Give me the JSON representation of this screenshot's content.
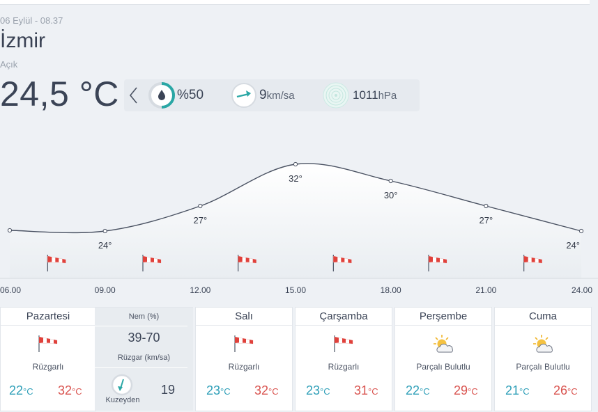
{
  "current": {
    "datetime": "06 Eylül - 08.37",
    "city": "İzmir",
    "condition": "Açık",
    "temperature": "24,5 °C"
  },
  "metrics": {
    "humidity": {
      "prefix": "%",
      "value": "50",
      "fill": 0.5
    },
    "wind": {
      "value": "9",
      "unit": "km/sa"
    },
    "pressure": {
      "value": "1011",
      "unit": "hPa"
    }
  },
  "colors": {
    "teal": "#2aa7a5",
    "hi": "#d9534f",
    "lo": "#2e9fb8",
    "flag_red": "#e0413b"
  },
  "chart_data": {
    "type": "line",
    "x": [
      "06.00",
      "09.00",
      "12.00",
      "15.00",
      "18.00",
      "21.00",
      "24.00"
    ],
    "points": [
      {
        "hour": 6,
        "temp": 24,
        "label": ""
      },
      {
        "hour": 9,
        "temp": 24,
        "label": "24°"
      },
      {
        "hour": 12,
        "temp": 27,
        "label": "27°"
      },
      {
        "hour": 15,
        "temp": 32,
        "label": "32°"
      },
      {
        "hour": 18,
        "temp": 30,
        "label": "30°"
      },
      {
        "hour": 21,
        "temp": 27,
        "label": "27°"
      },
      {
        "hour": 24,
        "temp": 24,
        "label": "24°"
      }
    ],
    "ylim": [
      22,
      33
    ],
    "wind_flags_count": 6
  },
  "today": {
    "day": "Pazartesi",
    "desc": "Rüzgarlı",
    "lo": "22",
    "hi": "32",
    "unit": "°C",
    "humidity_label": "Nem (%)",
    "humidity_range": "39-70",
    "wind_label": "Rüzgar (km/sa)",
    "wind_dir": "Kuzeyden",
    "wind_speed": "19"
  },
  "forecast": [
    {
      "day": "Salı",
      "icon": "windsock-icon",
      "desc": "Rüzgarlı",
      "lo": "23",
      "hi": "32",
      "unit": "°C"
    },
    {
      "day": "Çarşamba",
      "icon": "windsock-icon",
      "desc": "Rüzgarlı",
      "lo": "23",
      "hi": "31",
      "unit": "°C"
    },
    {
      "day": "Perşembe",
      "icon": "partly-cloudy-icon",
      "desc": "Parçalı Bulutlu",
      "lo": "22",
      "hi": "29",
      "unit": "°C"
    },
    {
      "day": "Cuma",
      "icon": "partly-cloudy-icon",
      "desc": "Parçalı Bulutlu",
      "lo": "21",
      "hi": "26",
      "unit": "°C"
    }
  ]
}
